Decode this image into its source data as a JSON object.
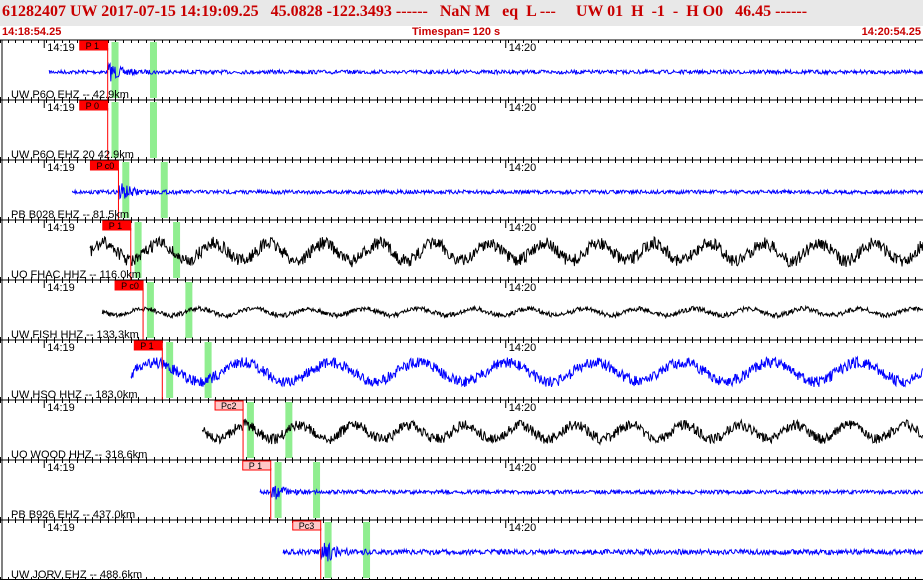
{
  "header": {
    "event_line": "61282407 UW 2017-07-15 14:19:09.25   45.0828 -122.3493 ------   NaN M   eq  L ---     UW 01  H  -1  -  H O0   46.45 ------"
  },
  "subheader": {
    "start_time": "14:18:54.25",
    "timespan": "Timespan= 120 s",
    "end_time": "14:20:54.25"
  },
  "tick_labels": {
    "first": "14:19",
    "second": "14:20"
  },
  "colors": {
    "header_bg": "#e8e8e8",
    "header_text": "#c80000",
    "trace_blue": "#0000ff",
    "trace_black": "#000000",
    "pick_red": "#ff0000",
    "pick_pink": "#ffc8c8",
    "window_green": "#90ee90"
  },
  "channels": [
    {
      "label": "UW P6O EHZ -- 42.9km",
      "color": "blue",
      "pick": "P 1",
      "pick_style": "red",
      "trace_start_s": 6.4,
      "onset_s": 14,
      "amp": 3
    },
    {
      "label": "UW P6O EHZ 20 42.9km",
      "color": "none",
      "pick": "P 0",
      "pick_style": "red",
      "trace_start_s": null,
      "onset_s": 14,
      "amp": 0
    },
    {
      "label": "PB B028 EHZ -- 81.5km",
      "color": "blue",
      "pick": "P c0",
      "pick_style": "red",
      "trace_start_s": 9.4,
      "onset_s": 15.4,
      "amp": 3
    },
    {
      "label": "UO FHAC HHZ -- 116.0km",
      "color": "black",
      "pick": "P 1",
      "pick_style": "red",
      "trace_start_s": 11.7,
      "onset_s": 17,
      "amp": 16
    },
    {
      "label": "UW FISH HHZ -- 133.3km",
      "color": "black",
      "pick": "P c0",
      "pick_style": "red",
      "trace_start_s": 13.3,
      "onset_s": 18.6,
      "amp": 6
    },
    {
      "label": "UW HSO HHZ -- 183.0km",
      "color": "blue",
      "pick": "P 1",
      "pick_style": "red",
      "trace_start_s": 17,
      "onset_s": 21.1,
      "amp": 16
    },
    {
      "label": "UO WOOD HHZ -- 318.6km",
      "color": "black",
      "pick": "Pc2",
      "pick_style": "pink",
      "trace_start_s": 26.3,
      "onset_s": 31.6,
      "amp": 13
    },
    {
      "label": "PB B926 EHZ -- 437.0km",
      "color": "blue",
      "pick": "P 1",
      "pick_style": "pink",
      "trace_start_s": 33.8,
      "onset_s": 35.2,
      "amp": 3
    },
    {
      "label": "UW JORV EHZ -- 488.6km",
      "color": "blue",
      "pick": "Pc3",
      "pick_style": "pink",
      "trace_start_s": 36.8,
      "onset_s": 41.7,
      "amp": 4
    }
  ]
}
